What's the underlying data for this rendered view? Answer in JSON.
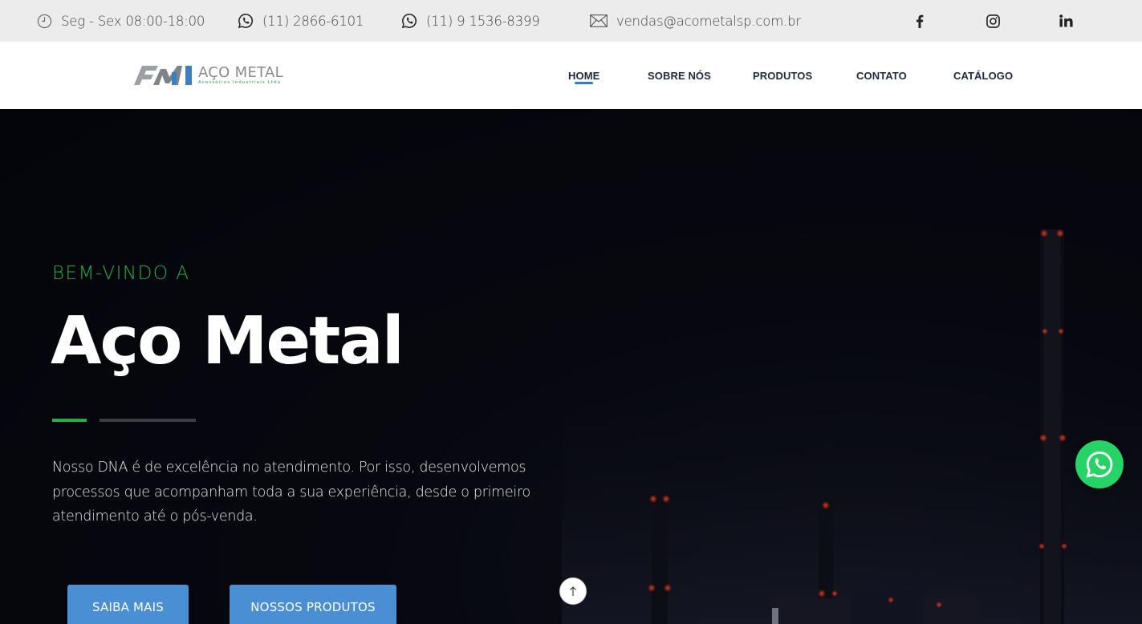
{
  "topbar": {
    "hours": "Seg - Sex 08:00-18:00",
    "phone1": "(11) 2866-6101",
    "phone2": "(11) 9 1536-8399",
    "email": "vendas@acometalsp.com.br",
    "social": [
      {
        "icon": "facebook-icon"
      },
      {
        "icon": "instagram-icon"
      },
      {
        "icon": "linkedin-icon"
      }
    ]
  },
  "header": {
    "logo": {
      "name": "AÇO METAL",
      "tagline": "Acessórios Industriais Ltda"
    },
    "nav": [
      {
        "label": "HOME",
        "active": true
      },
      {
        "label": "SOBRE NÓS"
      },
      {
        "label": "PRODUTOS"
      },
      {
        "label": "CONTATO"
      },
      {
        "label": "CATÁLOGO"
      }
    ]
  },
  "hero": {
    "eyebrow": "BEM-VINDO A",
    "title": "Aço Metal",
    "description": "Nosso DNA é de excelência no atendimento. Por isso, desenvolvemos processos que acompanham toda a sua experiência, desde o primeiro atendimento até o pós-venda.",
    "buttons": {
      "primary": "SAIBA MAIS",
      "secondary": "NOSSOS PRODUTOS"
    }
  },
  "colors": {
    "accent_green": "#1fb04a",
    "accent_blue": "#4a8fd4",
    "nav_underline": "#2f7dc6",
    "whatsapp": "#25d366"
  }
}
